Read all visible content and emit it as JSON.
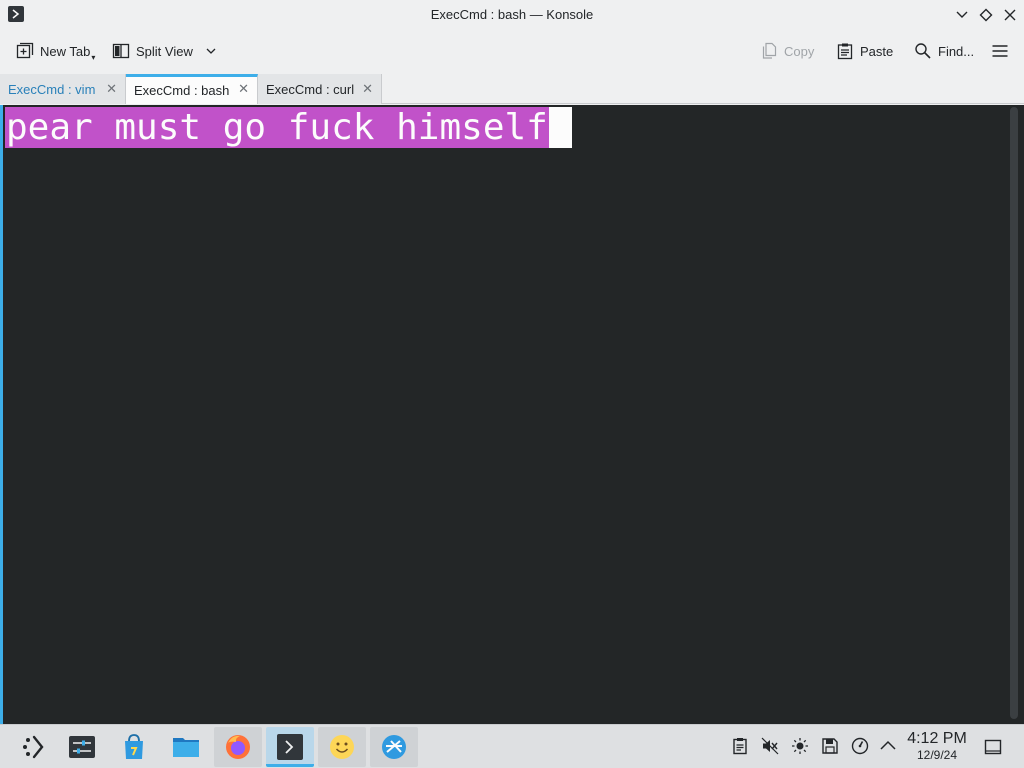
{
  "window": {
    "title": "ExecCmd : bash — Konsole"
  },
  "toolbar": {
    "new_tab": "New Tab",
    "split_view": "Split View",
    "copy": "Copy",
    "paste": "Paste",
    "find": "Find..."
  },
  "tabs": [
    {
      "label": "ExecCmd : vim",
      "state": "inactive"
    },
    {
      "label": "ExecCmd : bash",
      "state": "active"
    },
    {
      "label": "ExecCmd : curl",
      "state": "inactive"
    }
  ],
  "terminal": {
    "selected_text": "pear must go fuck himself"
  },
  "taskbar": {
    "time": "4:12 PM",
    "date": "12/9/24",
    "apps": [
      "launcher-icon",
      "system-settings-icon",
      "discover-store-icon",
      "file-manager-icon",
      "firefox-icon",
      "konsole-icon",
      "emoji-icon",
      "network-icon"
    ]
  },
  "colors": {
    "accent": "#3daee9",
    "selection": "#c152c9",
    "terminal_bg": "#232627"
  }
}
